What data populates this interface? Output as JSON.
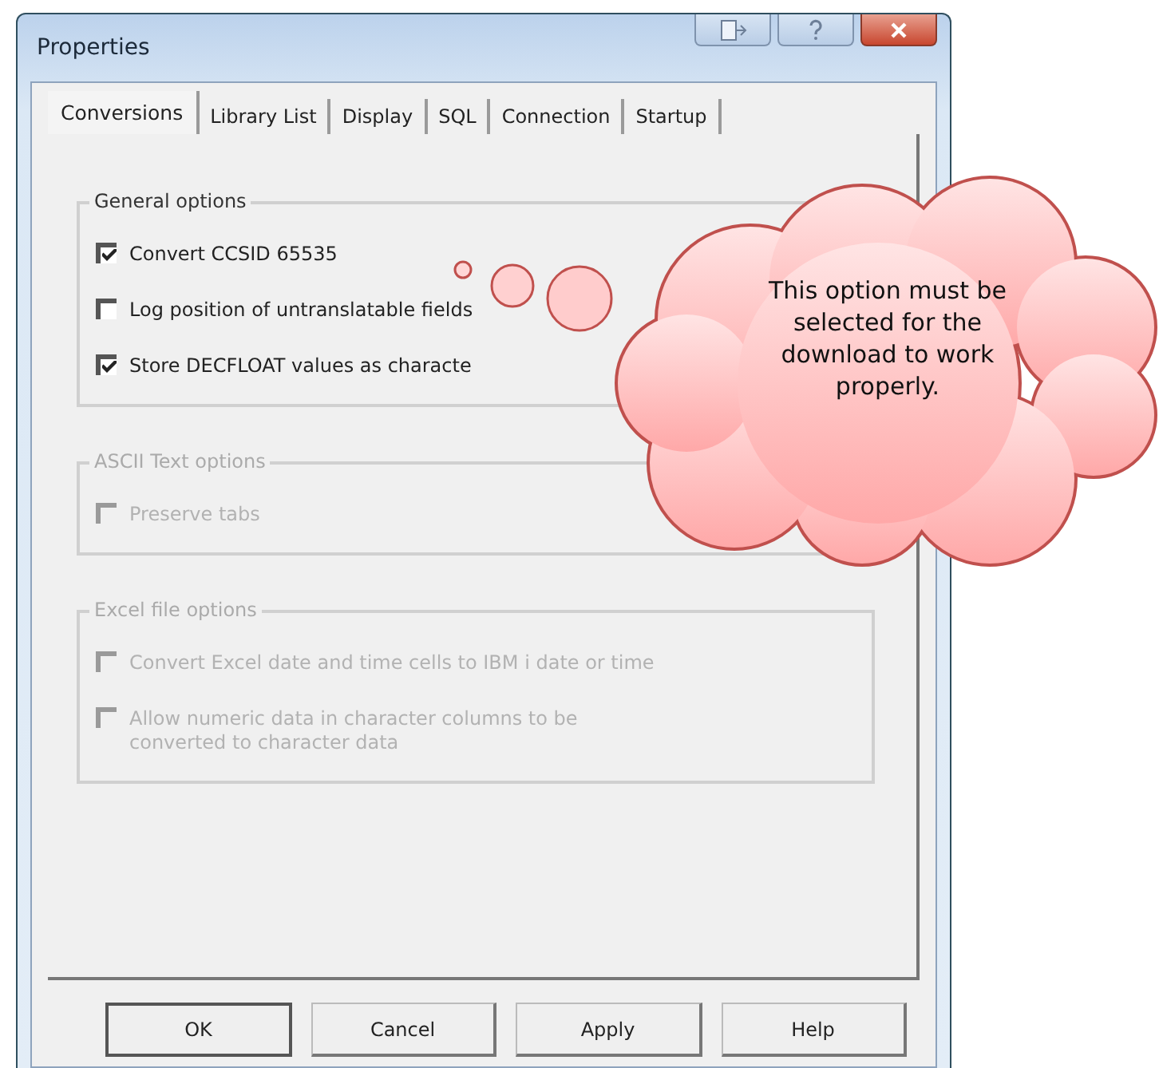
{
  "window": {
    "title": "Properties"
  },
  "tabs": [
    {
      "label": "Conversions",
      "selected": true
    },
    {
      "label": "Library List",
      "selected": false
    },
    {
      "label": "Display",
      "selected": false
    },
    {
      "label": "SQL",
      "selected": false
    },
    {
      "label": "Connection",
      "selected": false
    },
    {
      "label": "Startup",
      "selected": false
    }
  ],
  "groups": [
    {
      "title": "General options",
      "disabled": false,
      "options": [
        {
          "label": "Convert CCSID 65535",
          "checked": true
        },
        {
          "label": "Log position of untranslatable fields",
          "checked": false
        },
        {
          "label": "Store DECFLOAT values as characte",
          "checked": true
        }
      ]
    },
    {
      "title": "ASCII Text options",
      "disabled": true,
      "options": [
        {
          "label": "Preserve tabs",
          "checked": false
        }
      ]
    },
    {
      "title": "Excel file options",
      "disabled": true,
      "options": [
        {
          "label": "Convert Excel date and time cells to IBM i date or time",
          "checked": false
        },
        {
          "label": "Allow numeric data in character columns to be converted to character data",
          "checked": false
        }
      ]
    }
  ],
  "buttons": [
    {
      "label": "OK",
      "default": true
    },
    {
      "label": "Cancel",
      "default": false
    },
    {
      "label": "Apply",
      "default": false
    },
    {
      "label": "Help",
      "default": false
    }
  ],
  "callout": {
    "text": "This option must be selected for the download to work properly."
  }
}
